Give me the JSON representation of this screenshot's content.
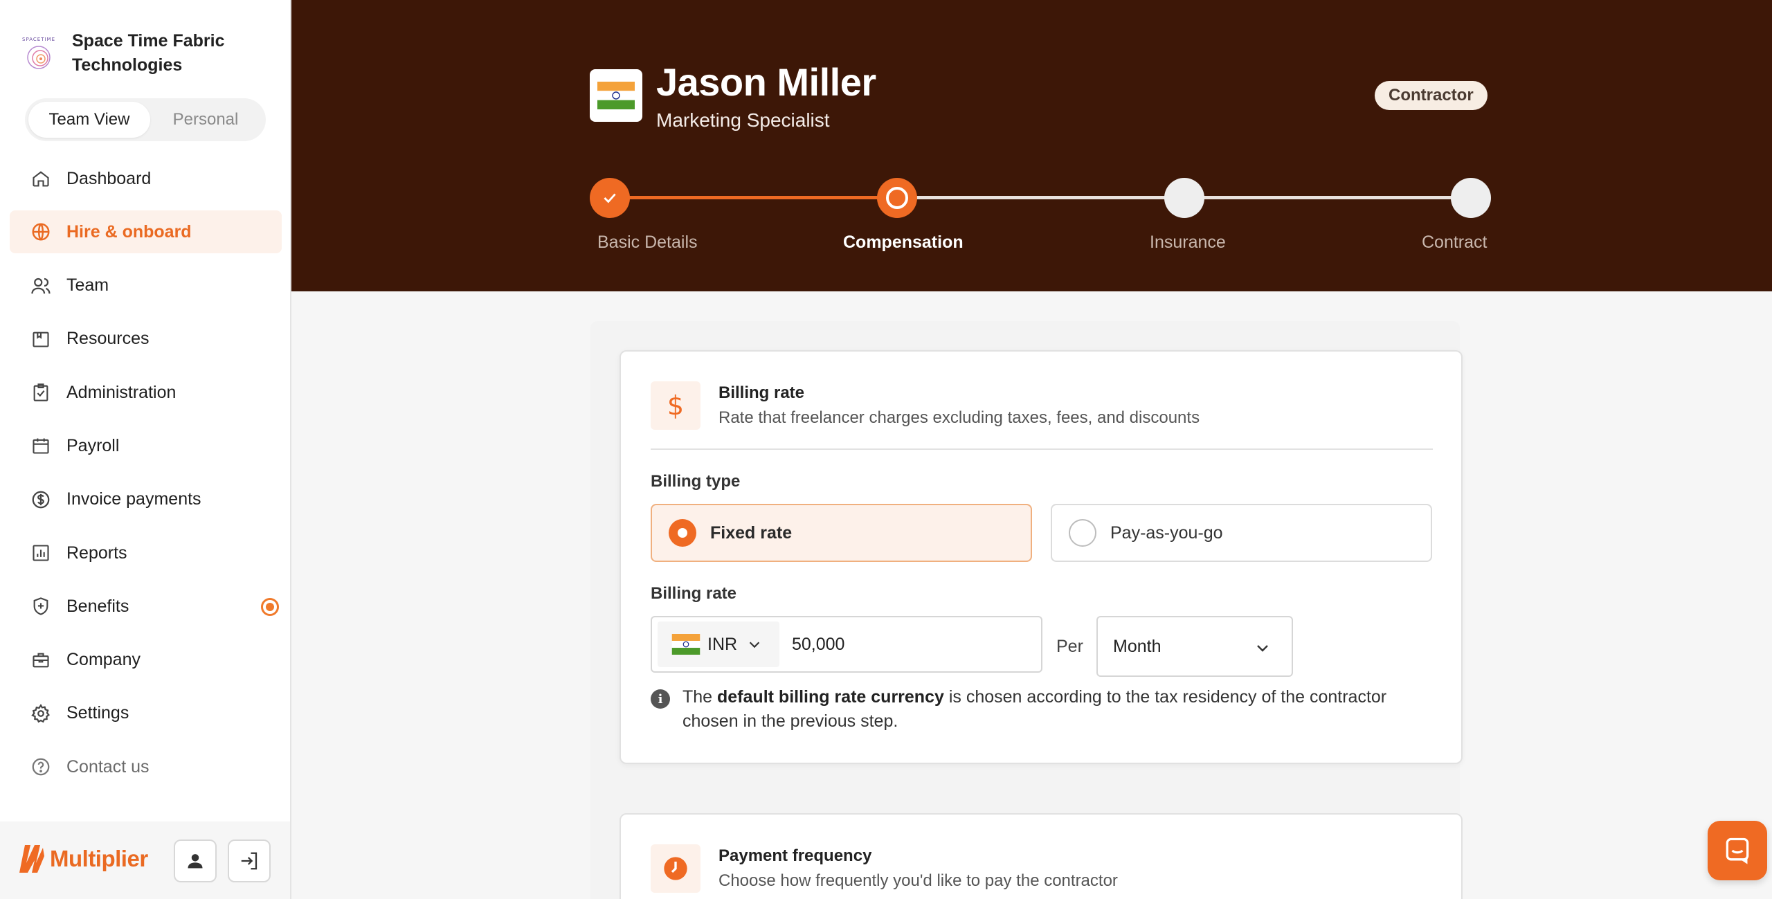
{
  "org": {
    "logo_text": "SPACETIME",
    "name": "Space Time Fabric Technologies"
  },
  "view_toggle": {
    "team": "Team View",
    "personal": "Personal"
  },
  "nav": [
    {
      "label": "Dashboard",
      "icon": "home-icon"
    },
    {
      "label": "Hire & onboard",
      "icon": "globe-icon",
      "active": true
    },
    {
      "label": "Team",
      "icon": "users-icon"
    },
    {
      "label": "Resources",
      "icon": "resources-icon"
    },
    {
      "label": "Administration",
      "icon": "clipboard-check-icon"
    },
    {
      "label": "Payroll",
      "icon": "calendar-icon"
    },
    {
      "label": "Invoice payments",
      "icon": "dollar-circle-icon"
    },
    {
      "label": "Reports",
      "icon": "bar-chart-icon"
    },
    {
      "label": "Benefits",
      "icon": "shield-plus-icon",
      "badge": true
    },
    {
      "label": "Company",
      "icon": "briefcase-icon"
    },
    {
      "label": "Settings",
      "icon": "gear-icon"
    },
    {
      "label": "Contact us",
      "icon": "question-circle-icon"
    }
  ],
  "brand": {
    "name": "Multiplier"
  },
  "header": {
    "name": "Jason Miller",
    "role": "Marketing Specialist",
    "badge": "Contractor",
    "steps": [
      "Basic Details",
      "Compensation",
      "Insurance",
      "Contract"
    ],
    "current_step": 1
  },
  "billing_section": {
    "title": "Billing rate",
    "subtitle": "Rate that freelancer charges excluding taxes, fees, and discounts",
    "type_label": "Billing type",
    "options": [
      "Fixed rate",
      "Pay-as-you-go"
    ],
    "selected_option": "Fixed rate",
    "rate_label": "Billing rate",
    "currency": "INR",
    "amount": "50,000",
    "per_label": "Per",
    "period": "Month",
    "info_prefix": "The ",
    "info_bold": "default billing rate currency",
    "info_suffix": " is chosen according to the tax residency of the contractor chosen in the previous step."
  },
  "payment_section": {
    "title": "Payment frequency",
    "subtitle": "Choose how frequently you'd like to pay the contractor"
  },
  "colors": {
    "accent": "#ef6a23",
    "header_bg": "#3d1707"
  }
}
